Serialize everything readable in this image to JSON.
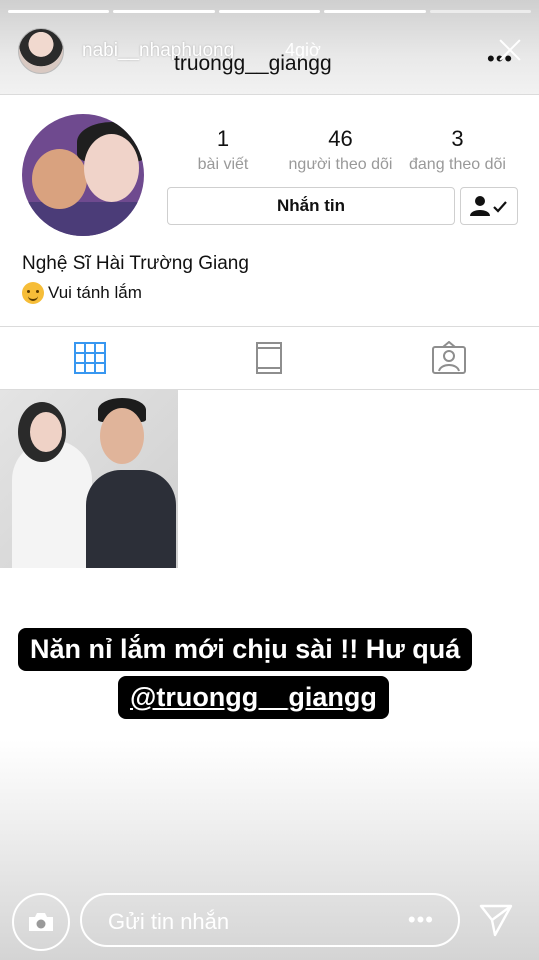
{
  "story": {
    "progress": {
      "segments": 5,
      "completed": 4
    },
    "username": "nabi__nhaphuong",
    "time": "4giờ",
    "close_icon": "close-icon"
  },
  "profile": {
    "username": "truongg__giangg",
    "menu": "•••",
    "stats": [
      {
        "value": "1",
        "label": "bài viết"
      },
      {
        "value": "46",
        "label": "người theo dõi"
      },
      {
        "value": "3",
        "label": "đang theo dõi"
      }
    ],
    "message_button": "Nhắn tin",
    "full_name": "Nghệ Sĩ Hài Trường Giang",
    "bio": "Vui tánh lắm",
    "tabs": [
      "grid-icon",
      "feed-icon",
      "tagged-icon"
    ],
    "active_tab": 0
  },
  "caption": {
    "line1": "Năn nỉ lắm mới chịu sài !! Hư quá",
    "mention": "@truongg__giangg"
  },
  "reply": {
    "placeholder": "Gửi tin nhắn",
    "dots": "•••"
  },
  "colors": {
    "accent_blue": "#3897f0",
    "stat_label_gray": "#999999",
    "border_gray": "#dbdbdb"
  }
}
